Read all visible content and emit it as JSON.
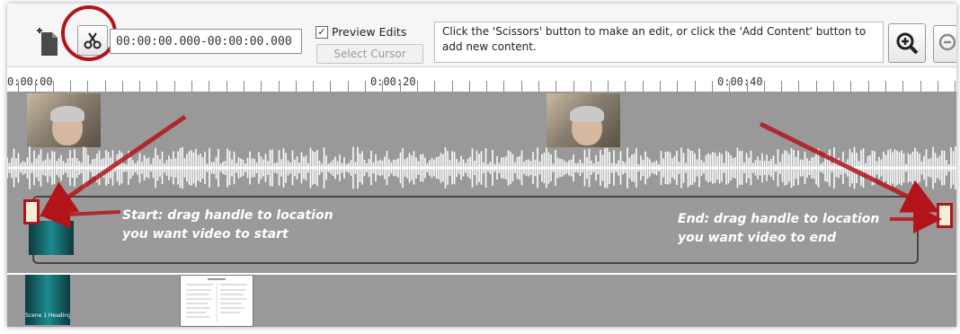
{
  "toolbar": {
    "timecode_value": "00:00:00.000-00:00:00.000",
    "preview_edits_label": "Preview Edits",
    "preview_edits_checked": true,
    "select_cursor_label": "Select Cursor",
    "help_text": "Click the 'Scissors' button to make an edit, or click the 'Add Content' button to add new content.",
    "icons": [
      "add-file-icon",
      "scissors-icon",
      "zoom-in-icon",
      "zoom-out-icon"
    ]
  },
  "ruler": {
    "labels": [
      "0:00:00",
      "0:00:20",
      "0:00:40"
    ]
  },
  "content_track": {
    "start_annotation_line1": "Start: drag handle to location",
    "start_annotation_line2": "you want video to start",
    "end_annotation_line1": "End: drag handle to location",
    "end_annotation_line2": "you want video to end"
  },
  "slides_track": {
    "clip_caption": "Scene 1 Heading"
  },
  "colors": {
    "annotation_red": "#b3141a",
    "track_gray": "#999999"
  }
}
